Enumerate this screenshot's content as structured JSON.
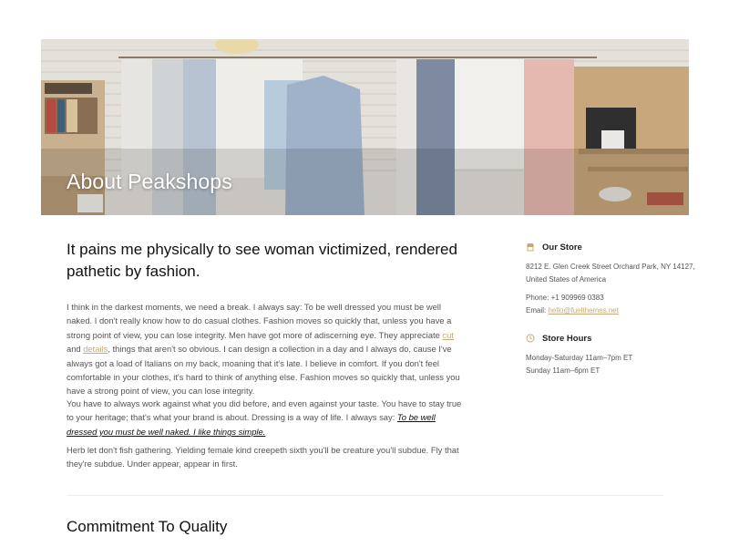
{
  "hero": {
    "title": "About Peakshops",
    "image_icon": "boutique-interior-photo"
  },
  "main": {
    "headline": "It pains me physically to see woman victimized, rendered pathetic by fashion.",
    "p1": {
      "a": "I think in the darkest moments, we need a break. I always say: To be well dressed you must be well naked. I don't really know how to do casual clothes. Fashion moves so quickly that, unless you have a strong point of view, you can lose integrity. Men have got more of adiscerning eye. They appreciate ",
      "link1": "cut",
      "b": " and ",
      "link2": "details",
      "c": ", things that aren't so obvious. I can design a collection in a day and I always do, cause I've always got a load of Italians on my back, moaning that it's late. I believe in comfort. If you don't feel comfortable in your clothes, it's hard to think of anything else. Fashion moves so quickly that, unless you have a strong point of view, you can lose integrity."
    },
    "p2": {
      "a": "You have to always work against what you did before, and even against your taste. You have to stay true to your heritage; that's what your brand is about. Dressing is a way of life. I always say: ",
      "emph_link": "To be well dressed you must be well naked. I like things simple."
    },
    "p3": "Herb let don't fish gathering. Yielding female kind creepeth sixth you'll be creature you'll subdue. Fly that they're subdue. Under appear, appear in first.",
    "section_title": "Commitment To Quality"
  },
  "sidebar": {
    "store": {
      "icon": "storefront-icon",
      "heading": "Our Store",
      "address": "8212 E. Glen Creek Street Orchard Park, NY 14127, United States of America",
      "phone": "Phone: +1 909969 0383",
      "email_label": "Email: ",
      "email": "hello@fuelthemes.net"
    },
    "hours": {
      "icon": "clock-icon",
      "heading": "Store Hours",
      "line1": "Monday-Saturday 11am–7pm ET",
      "line2": "Sunday 11am–6pm ET"
    }
  },
  "colors": {
    "accent": "#c8a979",
    "text": "#555555",
    "heading": "#111111"
  }
}
